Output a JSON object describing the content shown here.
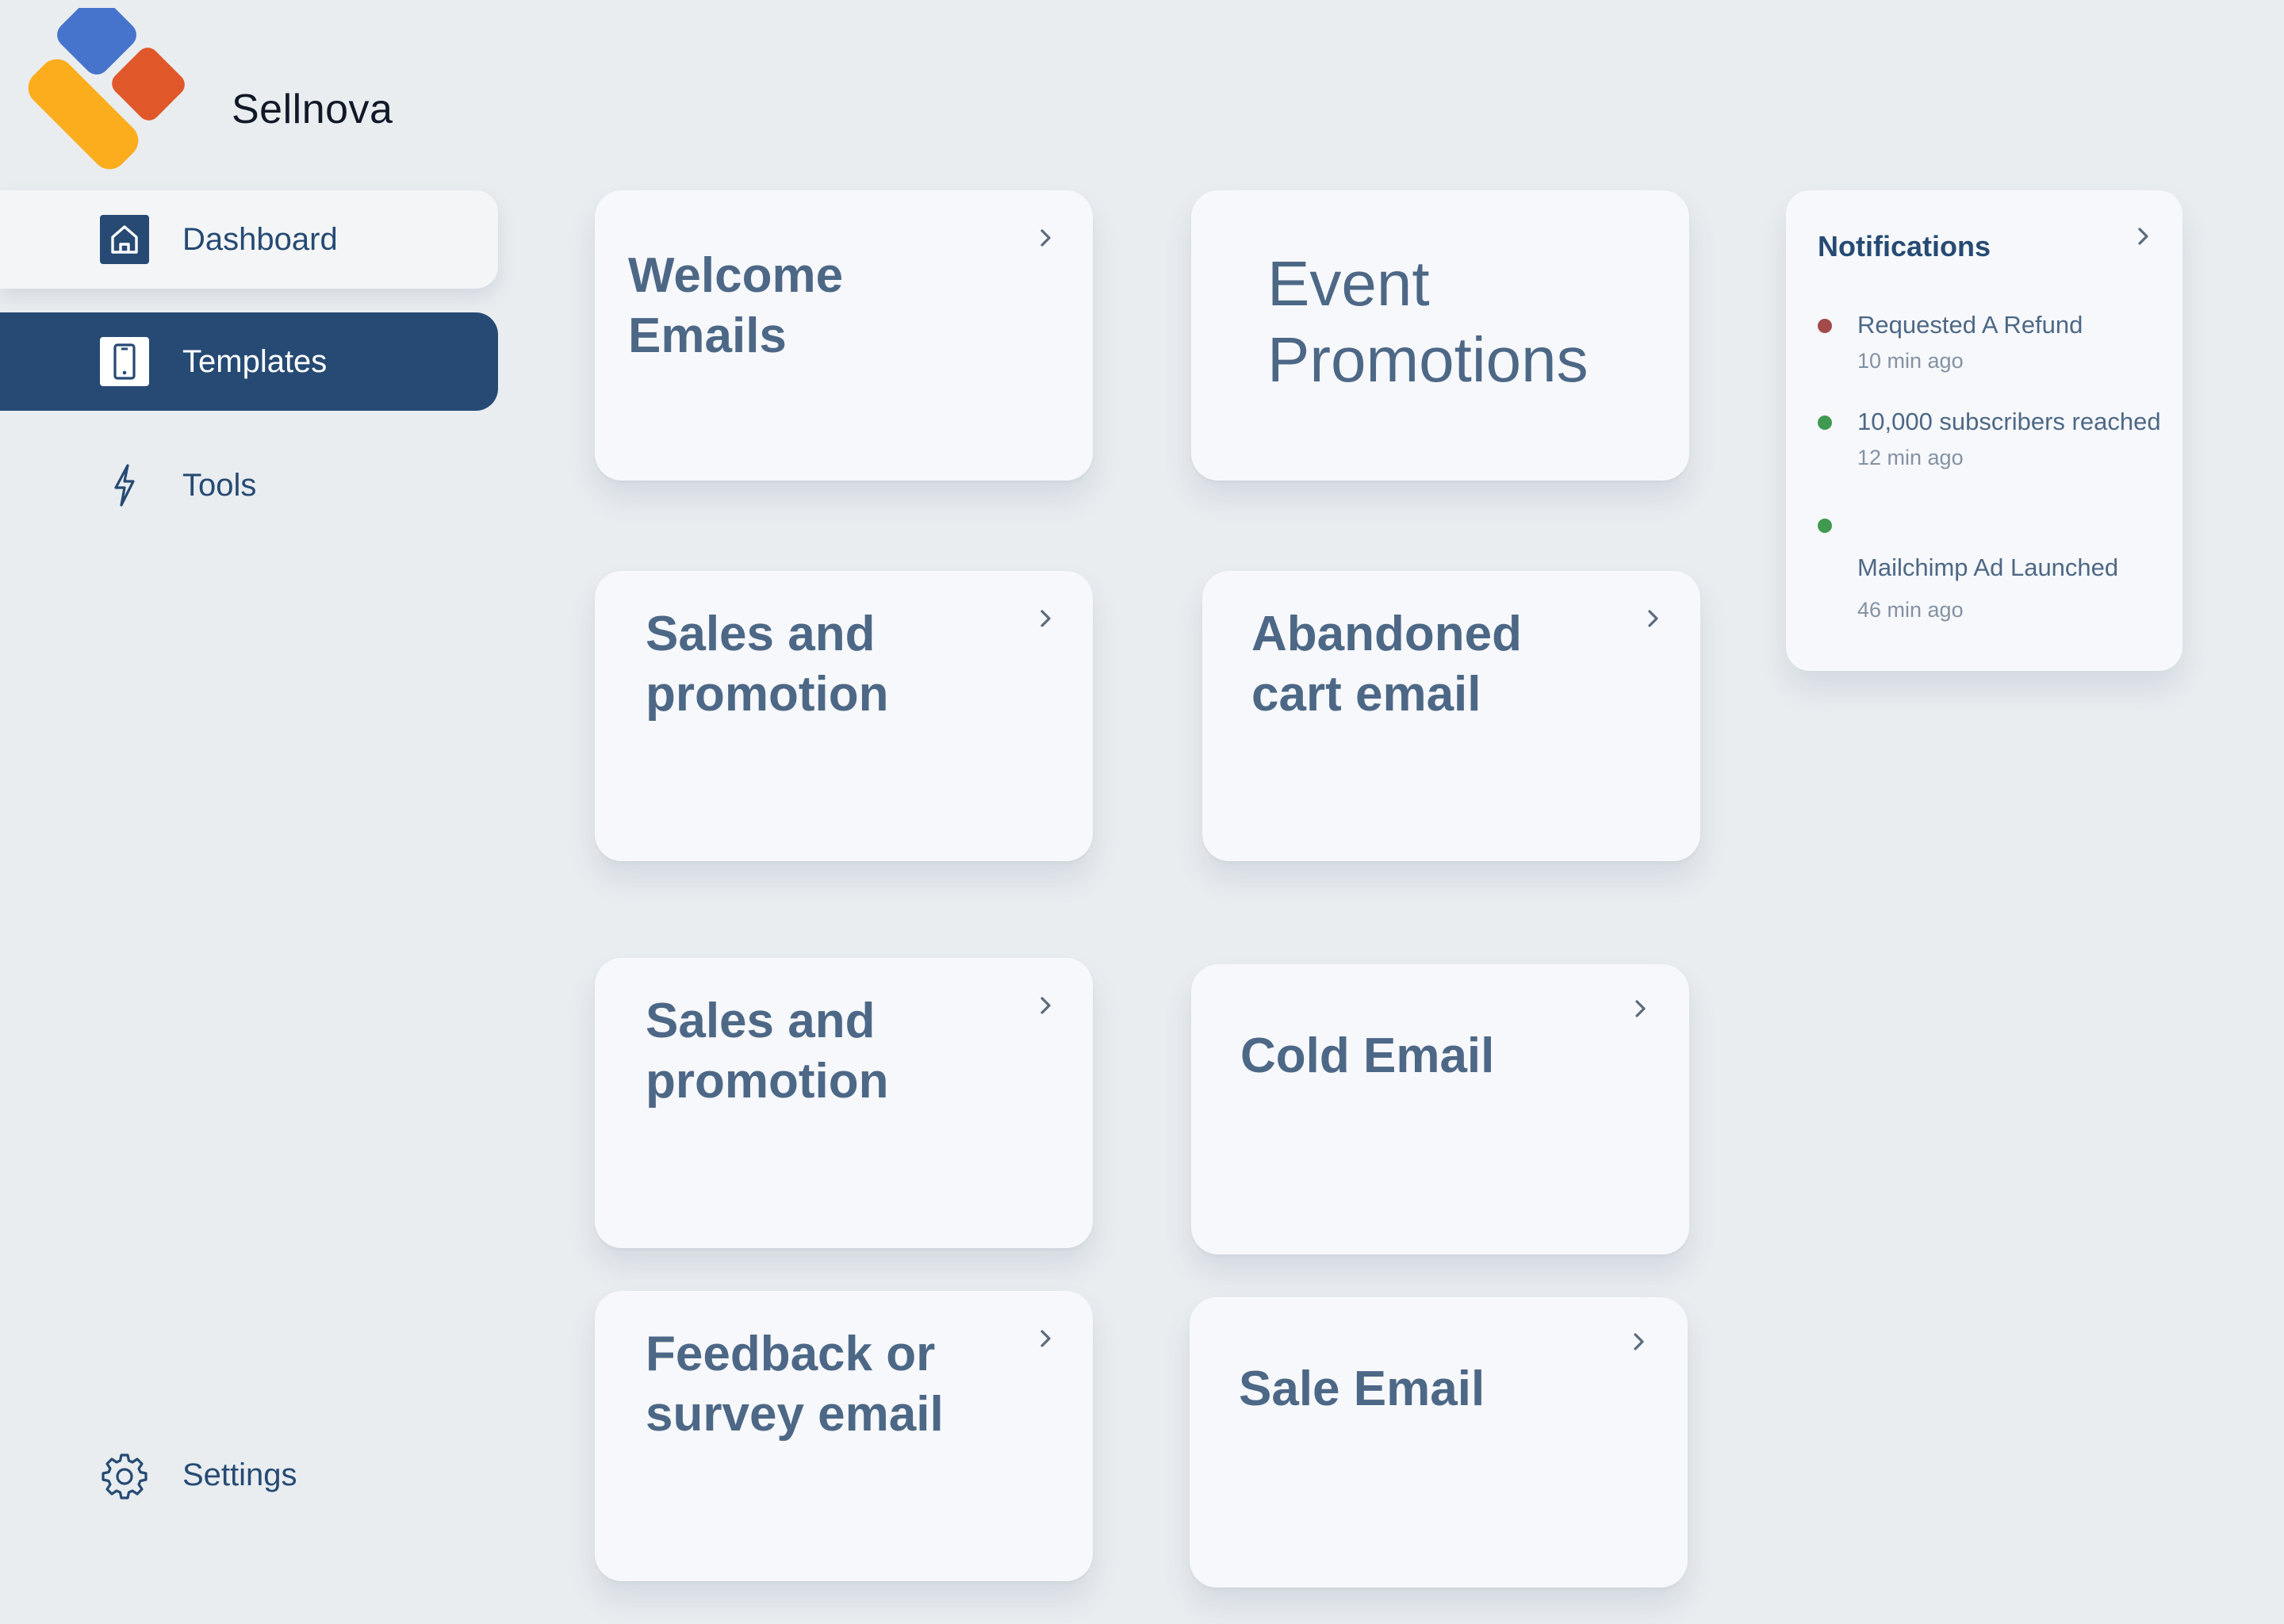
{
  "brand": {
    "name": "Sellnova",
    "logo_colors": {
      "blue": "#4674cc",
      "orange": "#e0582a",
      "yellow": "#fbad1e"
    }
  },
  "nav": {
    "dashboard": {
      "label": "Dashboard",
      "icon": "home-icon"
    },
    "templates": {
      "label": "Templates",
      "icon": "phone-icon",
      "active": true
    },
    "tools": {
      "label": "Tools",
      "icon": "lightning-icon"
    },
    "settings": {
      "label": "Settings",
      "icon": "gear-icon"
    }
  },
  "cards": {
    "welcome": {
      "line1": "Welcome",
      "line2": "Emails"
    },
    "event": {
      "line1": "Event",
      "line2": "Promotions"
    },
    "sales1": {
      "line1": "Sales and",
      "line2": "promotion"
    },
    "abandoned": {
      "line1": "Abandoned",
      "line2": "cart email"
    },
    "sales2": {
      "line1": "Sales and",
      "line2": "promotion"
    },
    "cold": {
      "line1": "Cold Email"
    },
    "feedback": {
      "line1": "Feedback or",
      "line2": "survey email"
    },
    "sale": {
      "line1": "Sale Email"
    }
  },
  "notifications": {
    "title": "Notifications",
    "items": [
      {
        "text": "Requested A Refund",
        "time": "10 min ago",
        "status_color": "#a34b4b"
      },
      {
        "text": "10,000 subscribers reached",
        "time": "12 min ago",
        "status_color": "#3f9a4f"
      },
      {
        "text": "Mailchimp Ad Launched",
        "time": "46 min ago",
        "status_color": "#3f9a4f"
      }
    ]
  },
  "colors": {
    "background": "#e9edf0",
    "navy": "#264a73",
    "card": "#f7f8fb",
    "card_text": "#4d6886"
  }
}
